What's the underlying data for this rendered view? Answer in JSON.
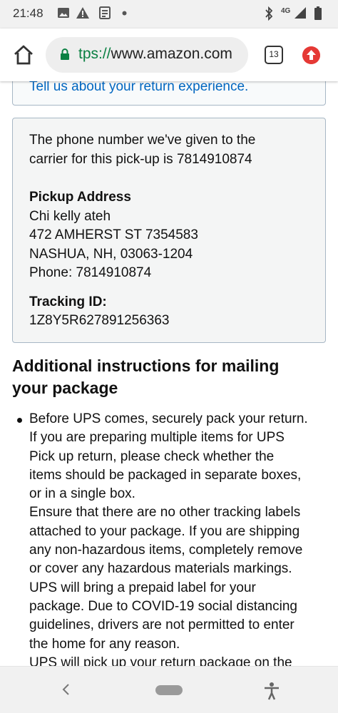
{
  "status_bar": {
    "time": "21:48",
    "icons": [
      "image-icon",
      "warning-icon",
      "news-icon",
      "dot-icon",
      "bluetooth-icon",
      "network-4g-icon",
      "signal-icon",
      "battery-icon"
    ],
    "network_label": "4G"
  },
  "browser": {
    "url_scheme": "tps://",
    "url_domain": "www.amazon.com",
    "tab_count": "13",
    "accent_update_color": "#e53935",
    "lock_color": "#0b8043"
  },
  "feedback_box": {
    "link_text": "Tell us about your return experience."
  },
  "pickup_box": {
    "phone_sentence_line1": "The phone number we've given to the",
    "phone_sentence_line2": "carrier for this pick-up is 7814910874",
    "address_heading": "Pickup Address",
    "address_name": "Chi kelly ateh",
    "address_street": "472 AMHERST ST 7354583",
    "address_city": "NASHUA, NH, 03063-1204",
    "address_phone": "Phone: 7814910874",
    "tracking_heading": "Tracking ID:",
    "tracking_id": "1Z8Y5R627891256363"
  },
  "instructions": {
    "heading_line1": "Additional instructions for mailing",
    "heading_line2": "your package",
    "lines": [
      "Before UPS comes, securely pack your return.",
      "If you are preparing multiple items for UPS",
      "Pick up return, please check whether the",
      "items should be packaged in separate boxes,",
      "or in a single box.",
      "Ensure that there are no other tracking labels",
      "attached to your package. If you are shipping",
      "any non-hazardous items, completely remove",
      "or cover any hazardous materials markings.",
      "UPS will bring a prepaid label for your",
      "package. Due to COVID-19 social distancing",
      "guidelines, drivers are not permitted to enter",
      "the home for any reason.",
      "UPS will pick up your return package on the"
    ]
  },
  "navbar": {
    "icons": [
      "back-icon",
      "home-pill-icon",
      "accessibility-icon"
    ]
  }
}
